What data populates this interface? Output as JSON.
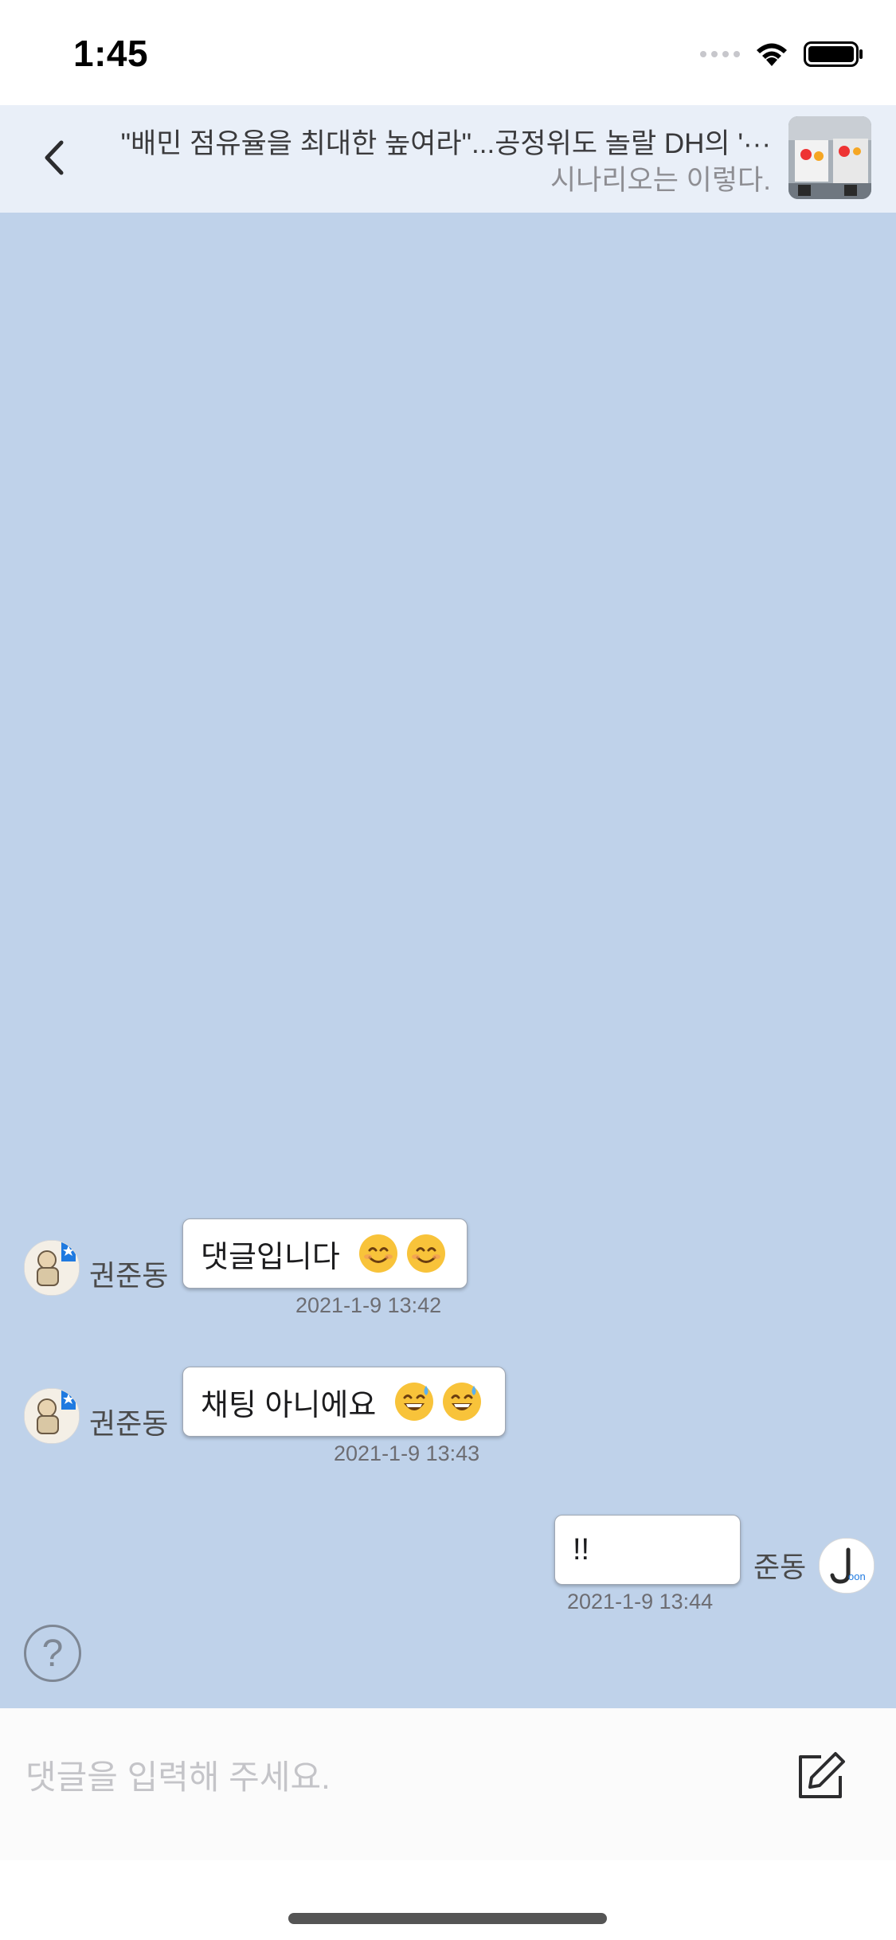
{
  "status_bar": {
    "time": "1:45"
  },
  "header": {
    "title": "\"배민 점유율을 최대한 높여라\"...공정위도 놀랄 DH의 '···",
    "subtitle": "시나리오는 이렇다."
  },
  "messages": [
    {
      "sender": "권준동",
      "text": "댓글입니다",
      "emoji": "😊",
      "timestamp": "2021-1-9 13:42",
      "side": "left"
    },
    {
      "sender": "권준동",
      "text": "채팅 아니에요",
      "emoji": "😅",
      "timestamp": "2021-1-9 13:43",
      "side": "left"
    },
    {
      "sender": "준동",
      "text": "!!",
      "timestamp": "2021-1-9 13:44",
      "side": "right"
    }
  ],
  "composer": {
    "placeholder": "댓글을 입력해 주세요."
  },
  "colors": {
    "chat_background": "#bfd2ea",
    "header_background": "#e9eff8",
    "avatar_badge": "#1f7ae0"
  },
  "icons": {
    "back": "chevron-left-icon",
    "help": "question-circle-icon",
    "compose": "edit-icon"
  }
}
